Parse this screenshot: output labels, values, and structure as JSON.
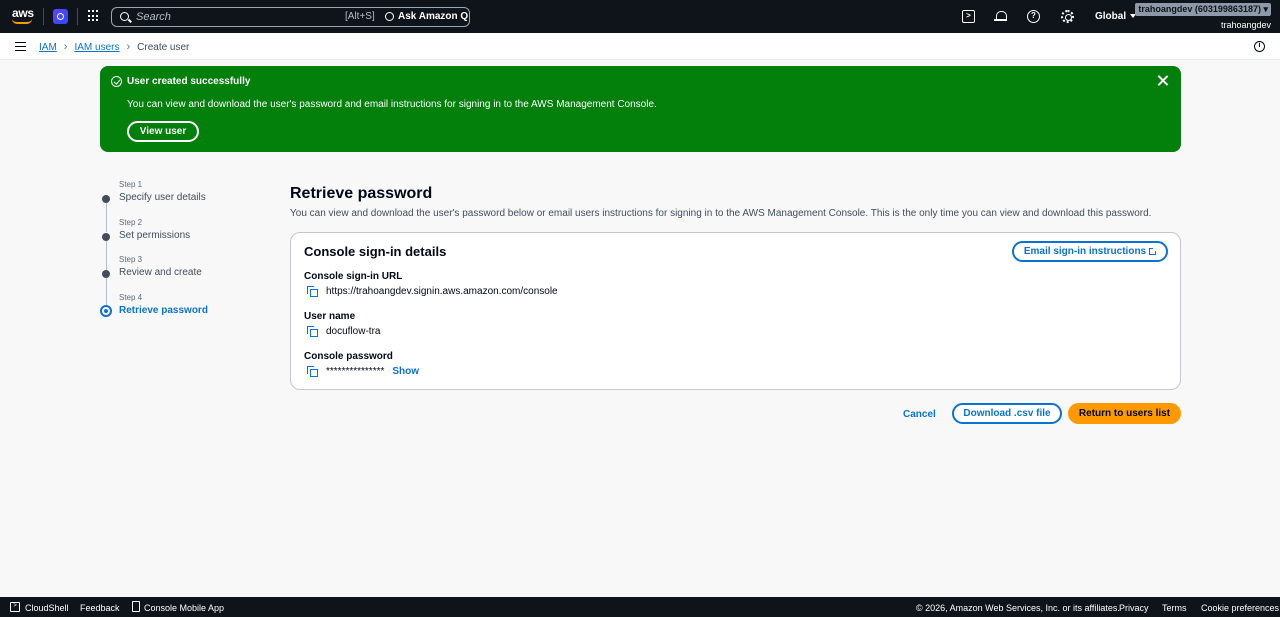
{
  "topnav": {
    "logo_text": "aws",
    "search": {
      "placeholder": "Search",
      "shortcut": "[Alt+S]",
      "ask_q_label": "Ask Amazon Q"
    },
    "region_label": "Global",
    "account_id": "trahoangdev (603199863187)",
    "account_name": "trahoangdev"
  },
  "breadcrumb": {
    "items": [
      {
        "label": "IAM"
      },
      {
        "label": "IAM users"
      }
    ],
    "current": "Create user"
  },
  "flash": {
    "title": "User created successfully",
    "message": "You can view and download the user's password and email instructions for signing in to the AWS Management Console.",
    "view_button": "View user",
    "color": "#037f0c"
  },
  "wizard_steps": [
    {
      "number": "Step 1",
      "label": "Specify user details"
    },
    {
      "number": "Step 2",
      "label": "Set permissions"
    },
    {
      "number": "Step 3",
      "label": "Review and create"
    },
    {
      "number": "Step 4",
      "label": "Retrieve password"
    }
  ],
  "content": {
    "heading": "Retrieve password",
    "description": "You can view and download the user's password below or email users instructions for signing in to the AWS Management Console. This is the only time you can view and download this password.",
    "card": {
      "title": "Console sign-in details",
      "email_button": "Email sign-in instructions",
      "fields": [
        {
          "label": "Console sign-in URL",
          "value": "https://trahoangdev.signin.aws.amazon.com/console"
        },
        {
          "label": "User name",
          "value": "docuflow-tra"
        },
        {
          "label": "Console password",
          "value": "***************",
          "action": "Show"
        }
      ]
    }
  },
  "actions": {
    "cancel": "Cancel",
    "download": "Download .csv file",
    "return": "Return to users list"
  },
  "footer": {
    "cloudshell": "CloudShell",
    "feedback": "Feedback",
    "mobile_app": "Console Mobile App",
    "copyright": "© 2026, Amazon Web Services, Inc. or its affiliates.",
    "privacy": "Privacy",
    "terms": "Terms",
    "cookies": "Cookie preferences"
  },
  "colors": {
    "accent": "#0972d3",
    "primary_button": "#ff9900",
    "nav_bg": "#0f141a",
    "success": "#037f0c"
  }
}
